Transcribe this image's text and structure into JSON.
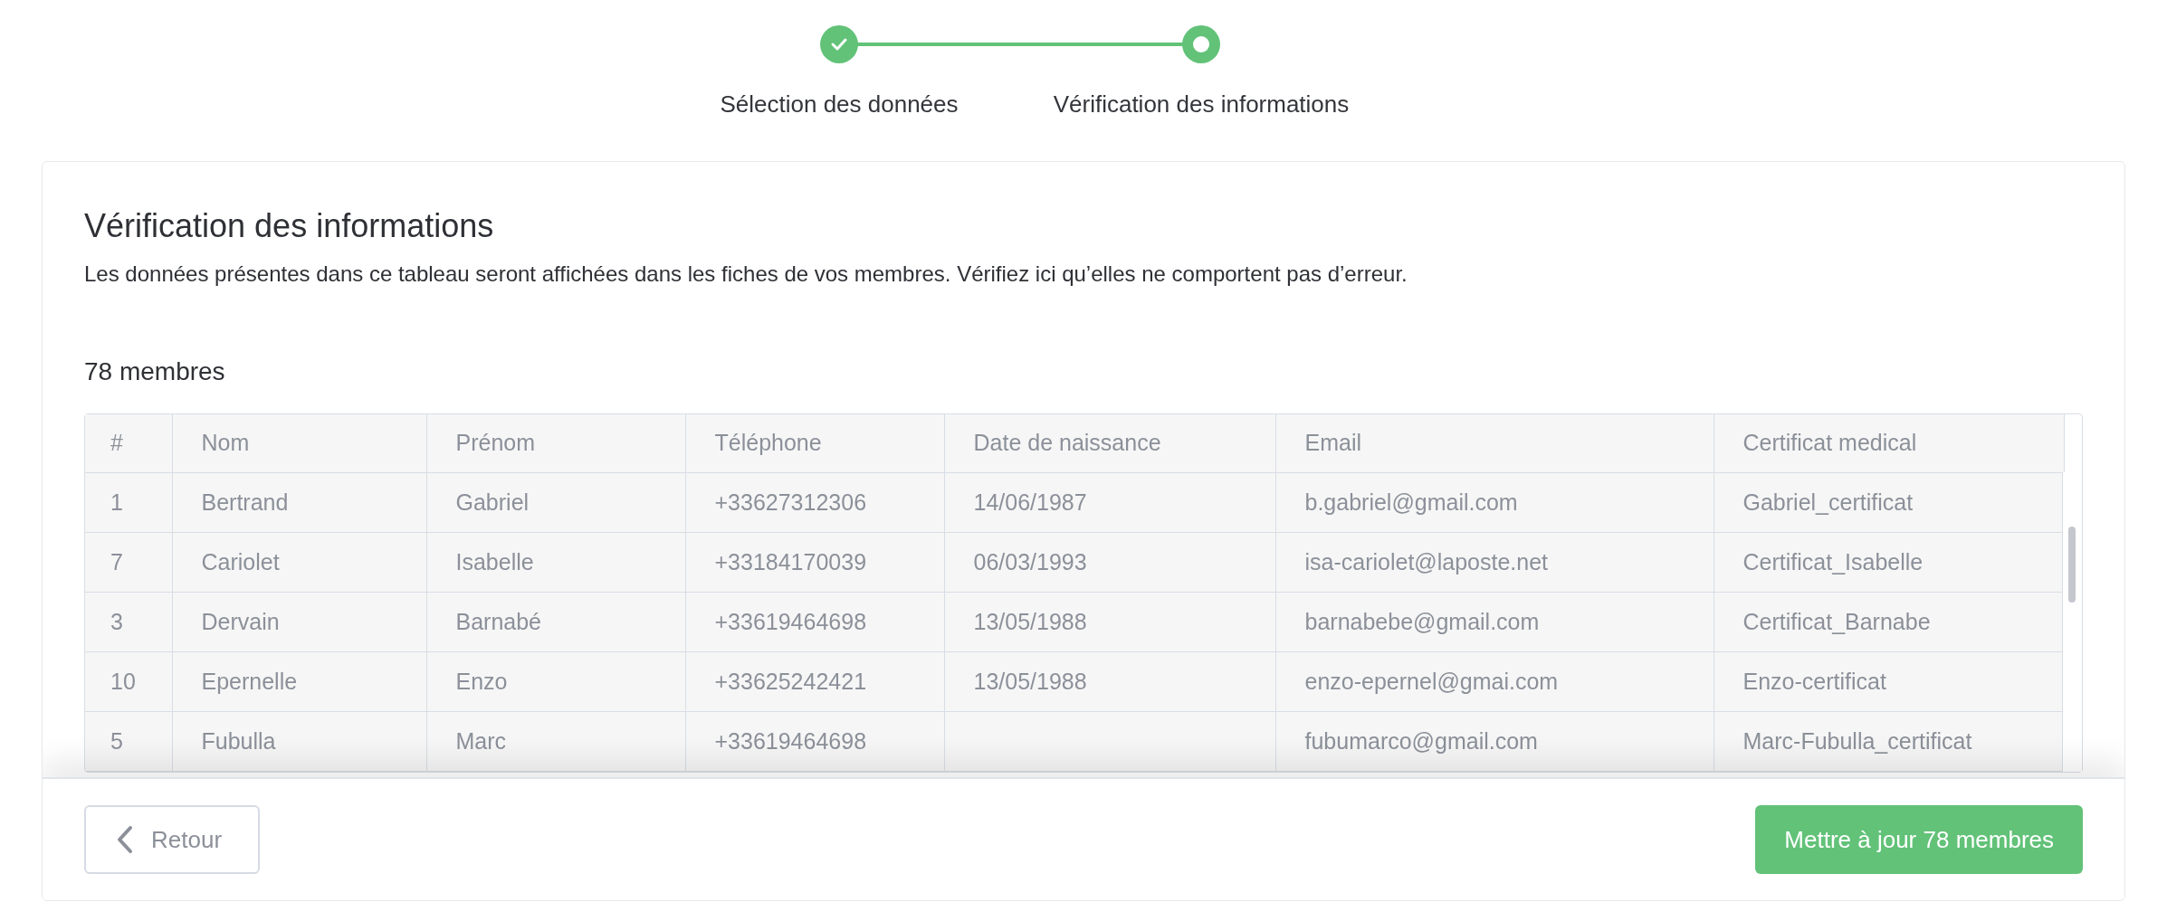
{
  "stepper": {
    "steps": [
      {
        "label": "Sélection des données",
        "completed": true
      },
      {
        "label": "Vérification des informations",
        "completed": false
      }
    ]
  },
  "card": {
    "title": "Vérification des informations",
    "description": "Les données présentes dans ce tableau seront affichées dans les fiches de vos membres. Vérifiez ici qu’elles ne comportent pas d’erreur.",
    "count": "78 membres"
  },
  "table": {
    "columns": [
      "#",
      "Nom",
      "Prénom",
      "Téléphone",
      "Date de naissance",
      "Email",
      "Certificat medical"
    ],
    "rows": [
      [
        "1",
        "Bertrand",
        "Gabriel",
        "+33627312306",
        "14/06/1987",
        "b.gabriel@gmail.com",
        "Gabriel_certificat"
      ],
      [
        "7",
        "Cariolet",
        "Isabelle",
        "+33184170039",
        "06/03/1993",
        "isa-cariolet@laposte.net",
        "Certificat_Isabelle"
      ],
      [
        "3",
        "Dervain",
        "Barnabé",
        "+33619464698",
        "13/05/1988",
        "barnabebe@gmail.com",
        "Certificat_Barnabe"
      ],
      [
        "10",
        "Epernelle",
        "Enzo",
        "+33625242421",
        "13/05/1988",
        "enzo-epernel@gmai.com",
        "Enzo-certificat"
      ],
      [
        "5",
        "Fubulla",
        "Marc",
        "+33619464698",
        "",
        "fubumarco@gmail.com",
        "Marc-Fubulla_certificat"
      ]
    ]
  },
  "footer": {
    "back": "Retour",
    "submit": "Mettre à jour 78 membres"
  }
}
